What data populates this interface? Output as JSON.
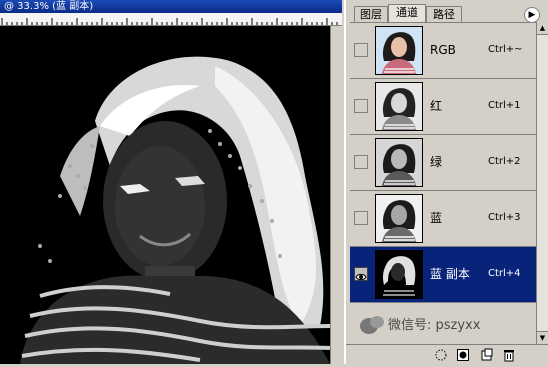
{
  "document": {
    "title": "@ 33.3% (蓝 副本)"
  },
  "panel": {
    "tabs": [
      {
        "label": "图层"
      },
      {
        "label": "通道",
        "active": true
      },
      {
        "label": "路径"
      }
    ],
    "menu_icon": "triangle-right-icon",
    "channels": [
      {
        "name": "RGB",
        "shortcut": "Ctrl+~",
        "visible": false,
        "selected": false,
        "thumb": "color"
      },
      {
        "name": "红",
        "shortcut": "Ctrl+1",
        "visible": false,
        "selected": false,
        "thumb": "gray"
      },
      {
        "name": "绿",
        "shortcut": "Ctrl+2",
        "visible": false,
        "selected": false,
        "thumb": "gray"
      },
      {
        "name": "蓝",
        "shortcut": "Ctrl+3",
        "visible": false,
        "selected": false,
        "thumb": "gray"
      },
      {
        "name": "蓝 副本",
        "shortcut": "Ctrl+4",
        "visible": true,
        "selected": true,
        "thumb": "dark"
      }
    ],
    "bottom_buttons": [
      {
        "icon": "load-selection-icon"
      },
      {
        "icon": "save-selection-icon"
      },
      {
        "icon": "new-channel-icon"
      },
      {
        "icon": "trash-icon"
      }
    ]
  },
  "watermark": {
    "text": "微信号: pszyxx"
  },
  "colors": {
    "selection": "#08247a",
    "panel_bg": "#d4d0c8",
    "title_bar": "#0a2a86"
  }
}
